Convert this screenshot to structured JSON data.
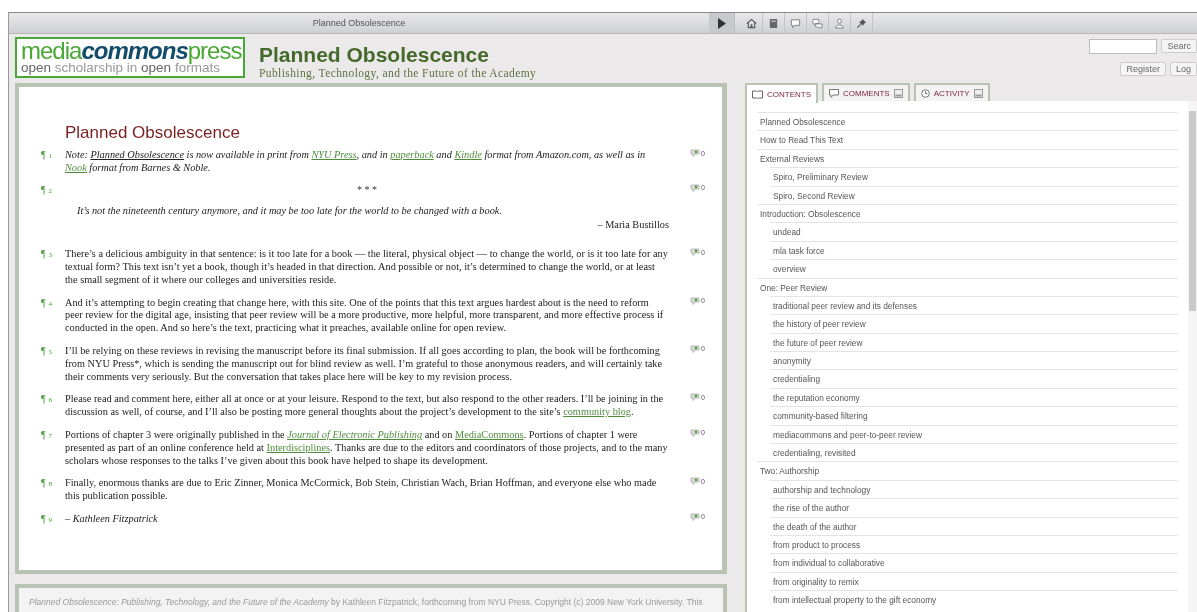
{
  "window": {
    "title": "Planned Obsolescence"
  },
  "toolbar": {
    "icons": [
      {
        "kind": "home"
      },
      {
        "kind": "book"
      },
      {
        "kind": "comment"
      },
      {
        "kind": "comments"
      },
      {
        "kind": "user"
      },
      {
        "kind": "pin"
      }
    ]
  },
  "header": {
    "logo": {
      "top_left": "media",
      "top_middle": "commons",
      "top_right": "press",
      "bottom": [
        {
          "text": "open",
          "strong": true
        },
        {
          "text": " scholarship in ",
          "strong": false
        },
        {
          "text": "open",
          "strong": true
        },
        {
          "text": " formats",
          "strong": false
        }
      ]
    },
    "title": "Planned Obsolescence",
    "subtitle": "Publishing, Technology, and the Future of the Academy",
    "search_button": "Searc",
    "register_button": "Register",
    "login_button": "Log"
  },
  "document": {
    "heading": "Planned Obsolescence",
    "paragraphs": [
      {
        "marker": "¶",
        "number": "1",
        "kind": "note",
        "comments": "0",
        "segments": [
          {
            "text": "Note: ",
            "kind": "plain"
          },
          {
            "text": "Planned Obsolescence",
            "kind": "underline"
          },
          {
            "text": " is now available in print from ",
            "kind": "plain"
          },
          {
            "text": "NYU Press",
            "kind": "link"
          },
          {
            "text": ", and in ",
            "kind": "plain"
          },
          {
            "text": "paperback",
            "kind": "link"
          },
          {
            "text": " and ",
            "kind": "plain"
          },
          {
            "text": "Kindle",
            "kind": "link"
          },
          {
            "text": " format from Amazon.com, as well as in ",
            "kind": "plain"
          },
          {
            "text": "Nook",
            "kind": "link"
          },
          {
            "text": " format from Barnes & Noble.",
            "kind": "plain"
          }
        ]
      },
      {
        "marker": "¶",
        "number": "2",
        "kind": "epigraph",
        "comments": "0",
        "separator": "* * *",
        "quote": "It’s not the nineteenth century anymore, and it may be too late for the world to be changed with a book.",
        "attribution": "– Maria Bustillos"
      },
      {
        "marker": "¶",
        "number": "3",
        "kind": "body",
        "comments": "0",
        "segments": [
          {
            "text": "There’s a delicious ambiguity in that sentence: is it too late for a book — the literal, physical object — to change the world, or is it too late for any textual form? This text isn’t yet a book, though it’s headed in that direction. And possible or not, it’s determined to change the world, or at least the small segment of it where our colleges and universities reside.",
            "kind": "plain"
          }
        ]
      },
      {
        "marker": "¶",
        "number": "4",
        "kind": "body",
        "comments": "0",
        "segments": [
          {
            "text": "And it’s attempting to begin creating that change here, with this site. One of the points that this text argues hardest about is the need to reform peer review for the digital age, insisting that peer review will be a more productive, more helpful, more transparent, and more effective process if conducted in the open. And so here’s the text, practicing what it preaches, available online for open review.",
            "kind": "plain"
          }
        ]
      },
      {
        "marker": "¶",
        "number": "5",
        "kind": "body",
        "comments": "0",
        "segments": [
          {
            "text": "I’ll be relying on these reviews in revising the manuscript before its final submission. If all goes according to plan, the book will be forthcoming from NYU Press*, which is sending the manuscript out for blind review as well. I’m grateful to those anonymous readers, and will certainly take their comments very seriously. But the conversation that takes place here will be key to my revision process.",
            "kind": "plain"
          }
        ]
      },
      {
        "marker": "¶",
        "number": "6",
        "kind": "body",
        "comments": "0",
        "segments": [
          {
            "text": "Please read and comment here, either all at once or at your leisure. Respond to the text, but also respond to the other readers. I’ll be joining in the discussion as well, of course, and I’ll also be posting more general thoughts about the project’s development to the site’s ",
            "kind": "plain"
          },
          {
            "text": "community blog",
            "kind": "link"
          },
          {
            "text": ".",
            "kind": "plain"
          }
        ]
      },
      {
        "marker": "¶",
        "number": "7",
        "kind": "body",
        "comments": "0",
        "segments": [
          {
            "text": "Portions of chapter 3 were originally published in the ",
            "kind": "plain"
          },
          {
            "text": "Journal of Electronic Publishing",
            "kind": "italic-link"
          },
          {
            "text": " and on ",
            "kind": "plain"
          },
          {
            "text": "MediaCommons",
            "kind": "link"
          },
          {
            "text": ". Portions of chapter 1 were presented as part of an online conference held at ",
            "kind": "plain"
          },
          {
            "text": "Interdisciplines",
            "kind": "link"
          },
          {
            "text": ". Thanks are due to the editors and coordinators of those projects, and to the many scholars whose responses to the talks I’ve given about this book have helped to shape its development.",
            "kind": "plain"
          }
        ]
      },
      {
        "marker": "¶",
        "number": "8",
        "kind": "body",
        "comments": "0",
        "segments": [
          {
            "text": "Finally, enormous thanks are due to Eric Zinner, Monica McCormick, Bob Stein, Christian Wach, Brian Hoffman, and everyone else who made this publication possible.",
            "kind": "plain"
          }
        ]
      },
      {
        "marker": "¶",
        "number": "9",
        "kind": "signature",
        "comments": "0",
        "segments": [
          {
            "text": "– Kathleen Fitzpatrick",
            "kind": "plain"
          }
        ]
      }
    ]
  },
  "footer": {
    "text": "*Planned Obsolescence: Publishing, Technology, and the Future of the Academy* by Kathleen Fitzpatrick, forthcoming from NYU Press. Copyright (c) 2009 New York University. This"
  },
  "sidebar": {
    "tabs": [
      {
        "label": "CONTENTS",
        "kind": "contents",
        "selected": true
      },
      {
        "label": "COMMENTS",
        "kind": "comments",
        "selected": false
      },
      {
        "label": "ACTIVITY",
        "kind": "activity",
        "selected": false
      }
    ],
    "items": [
      {
        "label": "Planned Obsolescence"
      },
      {
        "label": "How to Read This Text"
      },
      {
        "label": "External Reviews",
        "children": [
          {
            "label": "Spiro, Preliminary Review"
          },
          {
            "label": "Spiro, Second Review"
          }
        ]
      },
      {
        "label": "Introduction: Obsolescence",
        "children": [
          {
            "label": "undead"
          },
          {
            "label": "mla task force"
          },
          {
            "label": "overview"
          }
        ]
      },
      {
        "label": "One: Peer Review",
        "children": [
          {
            "label": "traditional peer review and its defenses"
          },
          {
            "label": "the history of peer review"
          },
          {
            "label": "the future of peer review"
          },
          {
            "label": "anonymity"
          },
          {
            "label": "credentialing"
          },
          {
            "label": "the reputation economy"
          },
          {
            "label": "community-based filtering"
          },
          {
            "label": "mediacommons and peer-to-peer review"
          },
          {
            "label": "credentialing, revisited"
          }
        ]
      },
      {
        "label": "Two: Authorship",
        "children": [
          {
            "label": "authorship and technology"
          },
          {
            "label": "the rise of the author"
          },
          {
            "label": "the death of the author"
          },
          {
            "label": "from product to process"
          },
          {
            "label": "from individual to collaborative"
          },
          {
            "label": "from originality to remix"
          },
          {
            "label": "from intellectual property to the gift economy"
          }
        ]
      }
    ]
  }
}
